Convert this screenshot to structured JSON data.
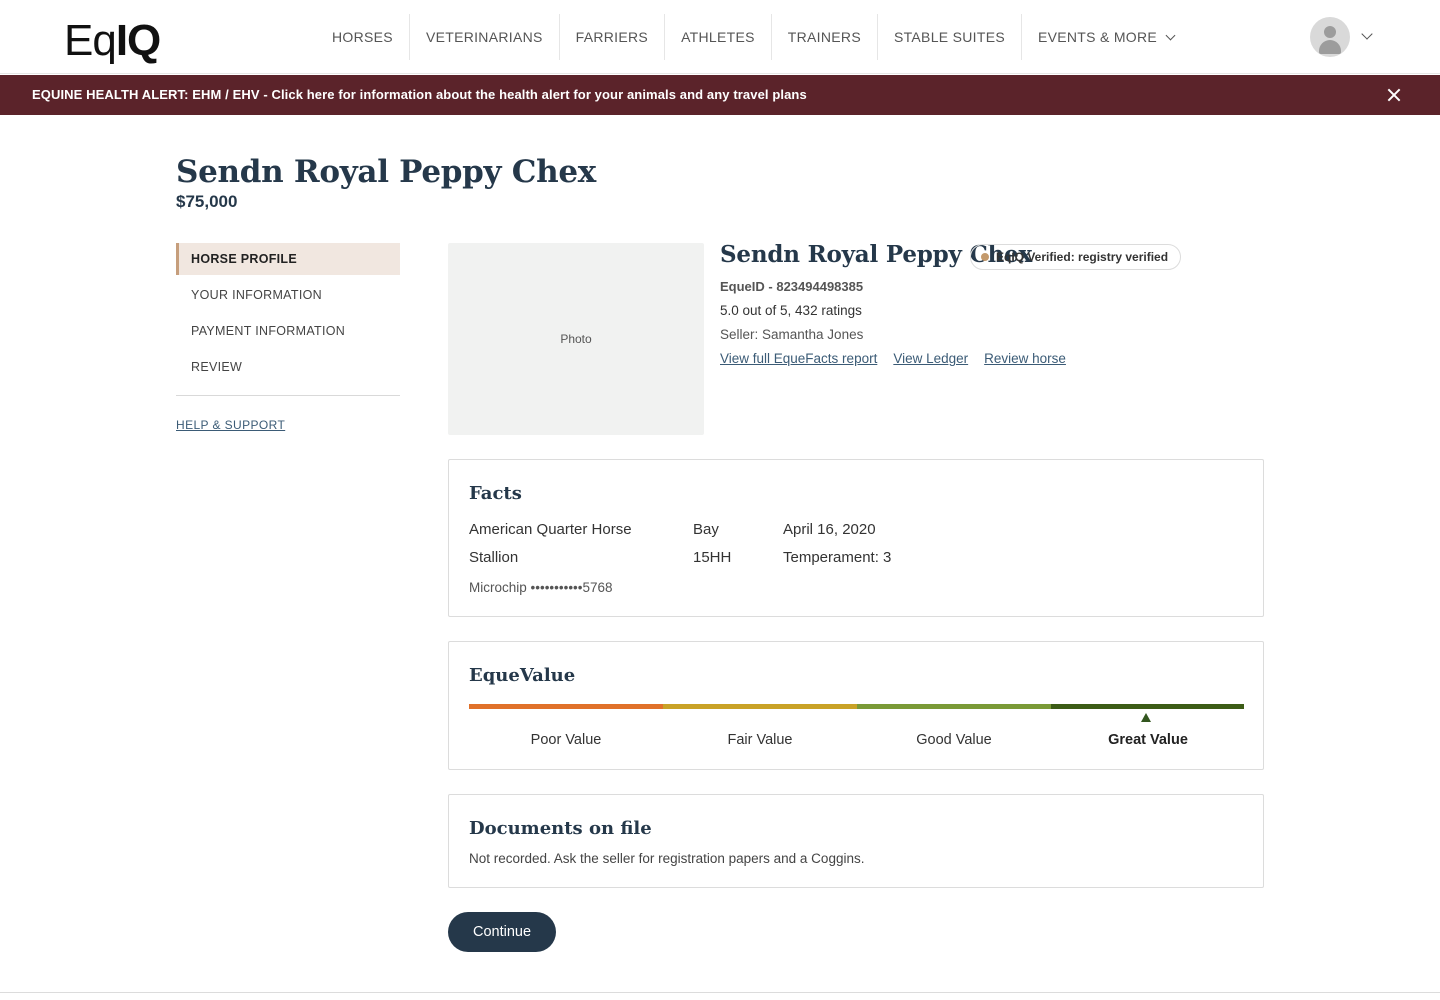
{
  "header": {
    "logo": {
      "light": "Eq",
      "bold": "IQ"
    },
    "nav": [
      "HORSES",
      "VETERINARIANS",
      "FARRIERS",
      "ATHLETES",
      "TRAINERS",
      "STABLE SUITES",
      "EVENTS & MORE"
    ]
  },
  "alert": {
    "text": "EQUINE HEALTH ALERT: EHM / EHV - Click here for information about the health alert for your animals and any travel plans"
  },
  "page": {
    "title": "Sendn Royal Peppy Chex",
    "price": "$75,000"
  },
  "sidebar": {
    "items": [
      "HORSE PROFILE",
      "YOUR INFORMATION",
      "PAYMENT INFORMATION",
      "REVIEW"
    ],
    "active": "HORSE PROFILE",
    "help": "HELP & SUPPORT"
  },
  "profile": {
    "photo_label": "Photo",
    "name": "Sendn Royal Peppy Chex",
    "badge": "EqIQ Verified: registry verified",
    "badge_color": "#c49a6c",
    "equeid": "EqueID - 823494498385",
    "ratings": "5.0 out of 5, 432 ratings",
    "seller": "Seller: Samantha Jones",
    "links": [
      "View full EqueFacts report",
      "View Ledger",
      "Review horse"
    ]
  },
  "facts": {
    "title": "Facts",
    "breed": "American Quarter Horse",
    "color": "Bay",
    "birth_date": "April 16, 2020",
    "sex": "Stallion",
    "height": "15HH",
    "temperament": "Temperament: 3",
    "microchip": "Microchip •••••••••••5768"
  },
  "equevalue": {
    "title": "EqueValue",
    "segments": [
      {
        "label": "Poor Value",
        "color": "#e0712a"
      },
      {
        "label": "Fair Value",
        "color": "#c9a227"
      },
      {
        "label": "Good Value",
        "color": "#7a9a37"
      },
      {
        "label": "Great Value",
        "color": "#3c5c16"
      }
    ],
    "selected": "Great Value"
  },
  "documents": {
    "title": "Documents on file",
    "text": "Not recorded. Ask the seller for registration papers and a Coggins."
  },
  "actions": {
    "continue": "Continue"
  }
}
